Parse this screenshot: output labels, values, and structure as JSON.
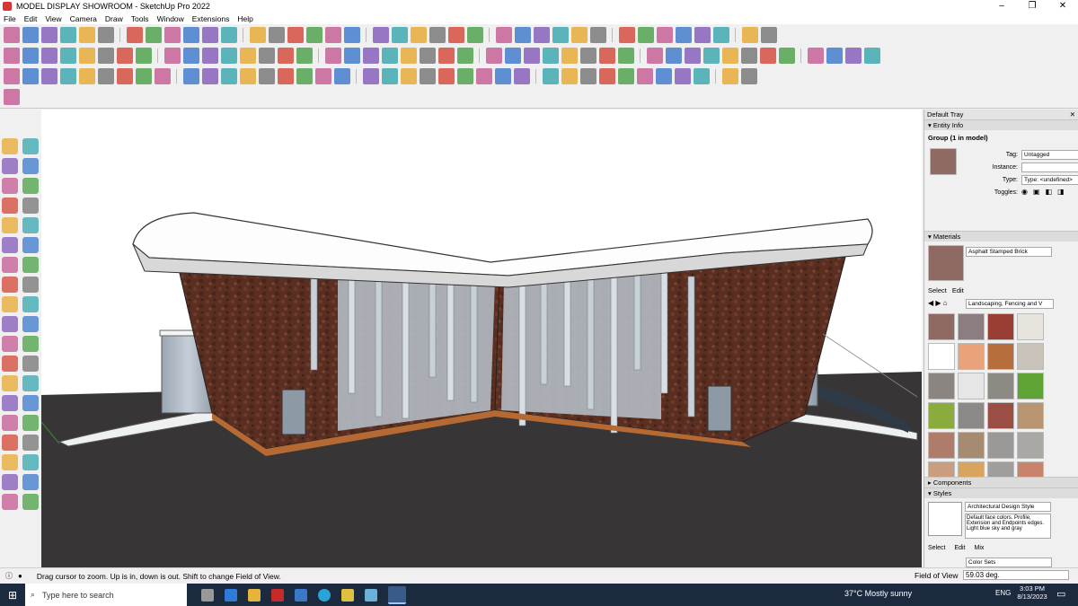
{
  "window": {
    "title": "MODEL DISPLAY SHOWROOM - SketchUp Pro 2022",
    "controls": [
      "–",
      "❐",
      "✕"
    ]
  },
  "menu": [
    "File",
    "Edit",
    "View",
    "Camera",
    "Draw",
    "Tools",
    "Window",
    "Extensions",
    "Help"
  ],
  "tray": {
    "title": "Default Tray",
    "entity_info": {
      "header": "Entity Info",
      "selection": "Group (1 in model)",
      "tag_label": "Tag:",
      "tag_value": "Untagged",
      "instance_label": "Instance:",
      "instance_value": "",
      "type_label": "Type:",
      "type_value": "Type: <undefined>",
      "toggles_label": "Toggles:"
    },
    "materials": {
      "header": "Materials",
      "material_name": "Asphalt Stamped Brick",
      "tabs": [
        "Select",
        "Edit"
      ],
      "collection": "Landscaping, Fencing and V",
      "swatch_colors": [
        "#8e6a62",
        "#8b7d80",
        "#9a3d35",
        "#e7e4de",
        "#ffffff",
        "#e8a37a",
        "#b66f3c",
        "#c8c2b8",
        "#8a8580",
        "#e6e6e6",
        "#8c8a82",
        "#5ea334",
        "#8aac3c",
        "#8b8a88",
        "#9d4e44",
        "#b89470",
        "#b07c6a",
        "#a58b70",
        "#9a9998",
        "#a9a8a5",
        "#c99e80",
        "#d8a45e",
        "#9f9e9a",
        "#c9826c"
      ]
    },
    "components": {
      "header": "Components"
    },
    "styles": {
      "header": "Styles",
      "style_name": "Architectural Design Style",
      "description": "Default face colors. Profile, Extension and Endpoints edges. Light blue sky and gray",
      "tabs": [
        "Select",
        "Edit",
        "Mix"
      ],
      "collection": "Color Sets"
    }
  },
  "statusbar": {
    "hint": "Drag cursor to zoom.  Up is in, down is out. Shift to change Field of View.",
    "measure_label": "Field of View",
    "measure_value": "59.03 deg."
  },
  "taskbar": {
    "search_placeholder": "Type here to search",
    "weather": "37°C  Mostly sunny",
    "language": "ENG",
    "time": "3:03 PM",
    "date": "8/13/2023"
  },
  "toolbar_colors": [
    "#d23a2a",
    "#2f6fc9",
    "#e6a321",
    "#3e9a3b",
    "#7a4fb5",
    "#6b6b6b",
    "#c24f8c",
    "#2aa0a8"
  ]
}
